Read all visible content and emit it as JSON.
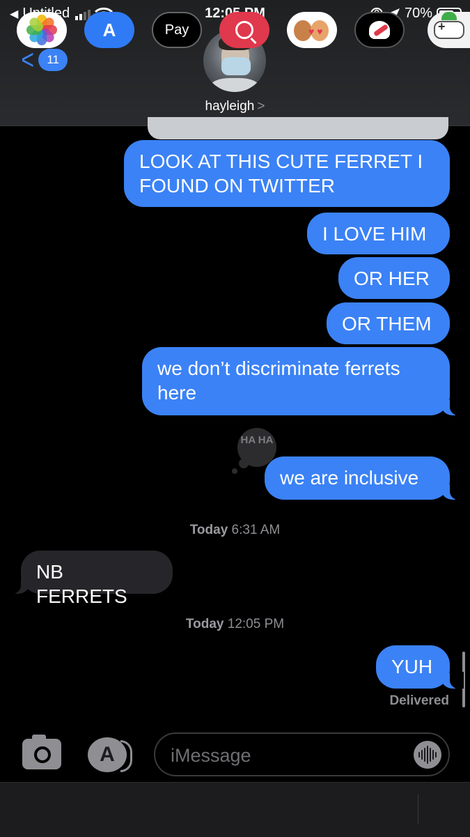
{
  "status_bar": {
    "back_app": "Untitled",
    "time": "12:05 PM",
    "battery": "70%",
    "battery_level": 0.7,
    "signal_bars": 2,
    "icons": [
      "back-triangle-icon",
      "signal-icon",
      "wifi-icon",
      "rotation-lock-icon",
      "location-icon",
      "battery-icon"
    ]
  },
  "header": {
    "back_badge": "11",
    "contact_name": "hayleigh",
    "contact_chevron": ">"
  },
  "messages": {
    "m1": "LOOK AT THIS CUTE FERRET I FOUND ON TWITTER",
    "m2": "I LOVE HIM",
    "m3": "OR HER",
    "m4": "OR THEM",
    "m5": "we don’t discriminate ferrets here",
    "m6": "we are inclusive",
    "m6_tapback": "HA HA",
    "stamp1_day": "Today",
    "stamp1_time": "6:31 AM",
    "m7": "NB FERRETS",
    "stamp2_day": "Today",
    "stamp2_time": "12:05 PM",
    "m8": "YUH",
    "delivered": "Delivered"
  },
  "input": {
    "placeholder": "iMessage"
  },
  "drawer": {
    "pay_label": "Pay",
    "apple_glyph": "",
    "apps": [
      "photos-app-icon",
      "app-store-icon",
      "apple-pay-icon",
      "web-search-icon",
      "memoji-icon",
      "digital-touch-icon",
      "game-app-icon"
    ]
  },
  "colors": {
    "outgoing_bubble": "#3b82f6",
    "incoming_bubble": "#26262a",
    "background": "#000000"
  }
}
